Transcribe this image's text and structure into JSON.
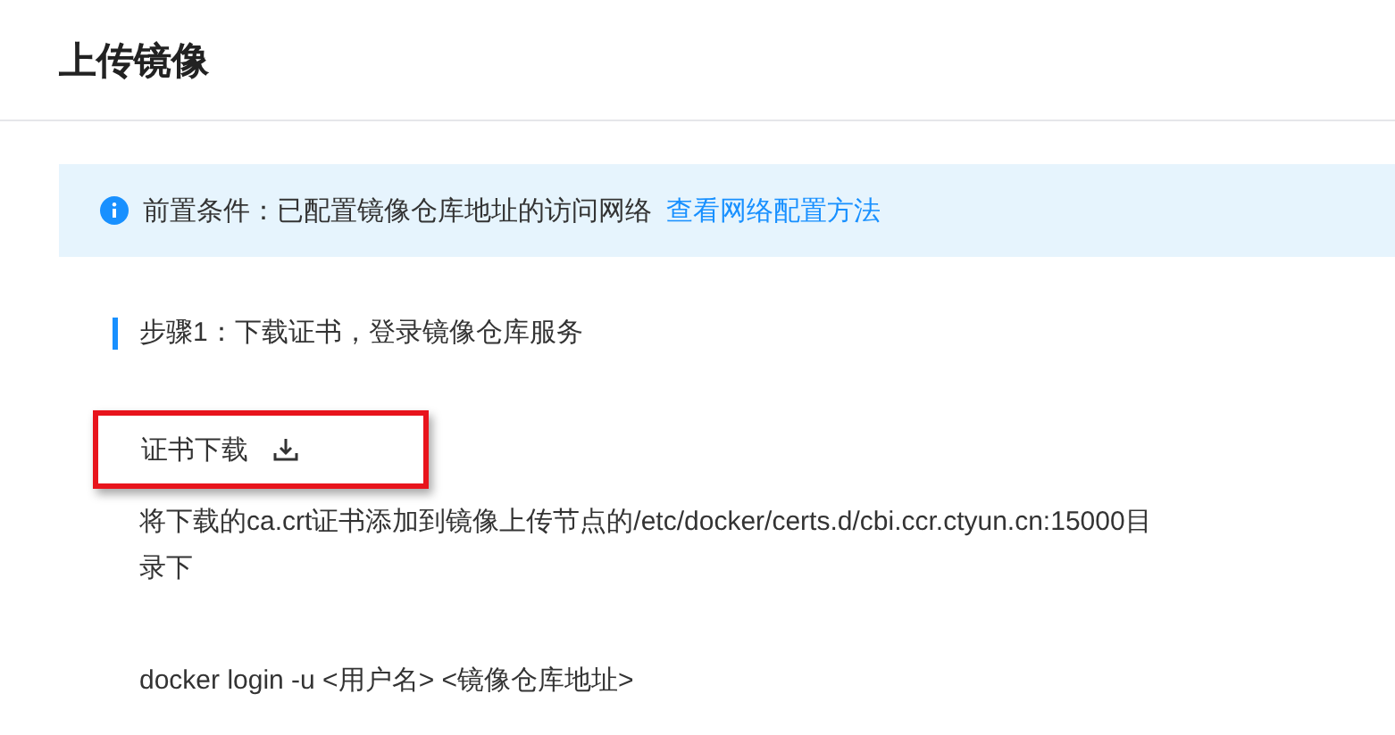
{
  "page_title": "上传镜像",
  "notice": {
    "text": "前置条件：已配置镜像仓库地址的访问网络",
    "link": "查看网络配置方法"
  },
  "step": {
    "title": "步骤1：下载证书，登录镜像仓库服务"
  },
  "download": {
    "label": "证书下载",
    "highlighted": true
  },
  "instructions": [
    "将下载的ca.crt证书添加到镜像上传节点的/etc/docker/certs.d/cbi.ccr.ctyun.cn:15000目录下",
    "docker login -u <用户名> <镜像仓库地址>"
  ]
}
